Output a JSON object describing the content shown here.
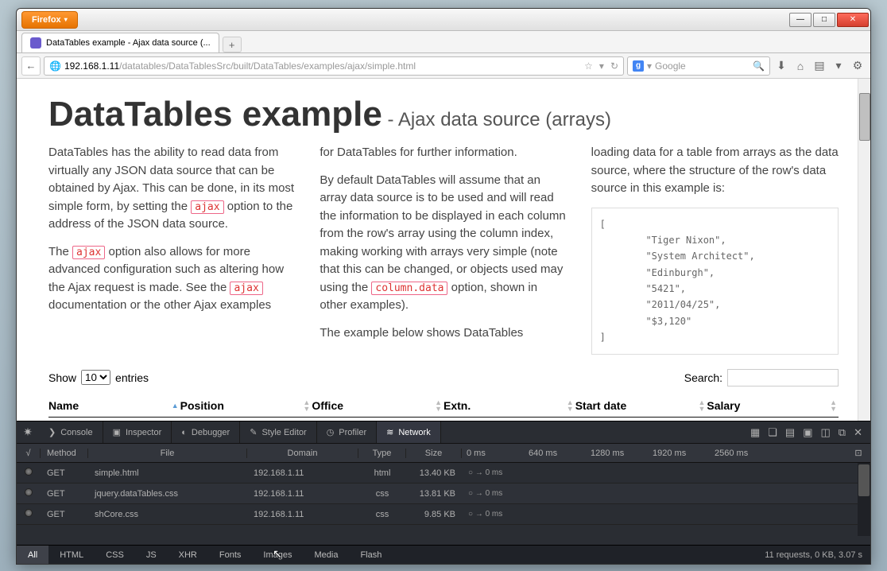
{
  "firefox_button": "Firefox",
  "tab_title": "DataTables example - Ajax data source (...",
  "url": {
    "host": "192.168.1.11",
    "path": "/datatables/DataTablesSrc/built/DataTables/examples/ajax/simple.html"
  },
  "search_placeholder": "Google",
  "page": {
    "title": "DataTables example",
    "subtitle": " - Ajax data source (arrays)",
    "col1_p1a": "DataTables has the ability to read data from virtually any JSON data source that can be obtained by Ajax. This can be done, in its most simple form, by setting the ",
    "col1_p1_code": "ajax",
    "col1_p1b": " option to the address of the JSON data source.",
    "col1_p2a": "The ",
    "col1_p2_code1": "ajax",
    "col1_p2b": " option also allows for more advanced configuration such as altering how the Ajax request is made. See the ",
    "col1_p2_code2": "ajax",
    "col1_p2c": " documentation or the other Ajax examples",
    "col2_p1": "for DataTables for further information.",
    "col2_p2a": "By default DataTables will assume that an array data source is to be used and will read the information to be displayed in each column from the row's array using the column index, making working with arrays very simple (note that this can be changed, or objects used may using the ",
    "col2_p2_code": "column.data",
    "col2_p2b": " option, shown in other examples).",
    "col2_p3": "The example below shows DataTables",
    "col3_p1": "loading data for a table from arrays as the data source, where the structure of the row's data source in this example is:",
    "code_block": "[\n        \"Tiger Nixon\",\n        \"System Architect\",\n        \"Edinburgh\",\n        \"5421\",\n        \"2011/04/25\",\n        \"$3,120\"\n]",
    "show_label": "Show",
    "show_value": "10",
    "entries_label": "entries",
    "search_label": "Search:",
    "headers": [
      "Name",
      "Position",
      "Office",
      "Extn.",
      "Start date",
      "Salary"
    ]
  },
  "devtools": {
    "tabs": {
      "console": "Console",
      "inspector": "Inspector",
      "debugger": "Debugger",
      "styleeditor": "Style Editor",
      "profiler": "Profiler",
      "network": "Network"
    },
    "net_headers": {
      "method": "Method",
      "file": "File",
      "domain": "Domain",
      "type": "Type",
      "size": "Size"
    },
    "time_marks": [
      "0 ms",
      "640 ms",
      "1280 ms",
      "1920 ms",
      "2560 ms"
    ],
    "rows": [
      {
        "method": "GET",
        "file": "simple.html",
        "domain": "192.168.1.11",
        "type": "html",
        "size": "13.40 KB",
        "time": "○ → 0 ms"
      },
      {
        "method": "GET",
        "file": "jquery.dataTables.css",
        "domain": "192.168.1.11",
        "type": "css",
        "size": "13.81 KB",
        "time": "○ → 0 ms"
      },
      {
        "method": "GET",
        "file": "shCore.css",
        "domain": "192.168.1.11",
        "type": "css",
        "size": "9.85 KB",
        "time": "○ → 0 ms"
      }
    ],
    "filters": [
      "All",
      "HTML",
      "CSS",
      "JS",
      "XHR",
      "Fonts",
      "Images",
      "Media",
      "Flash"
    ],
    "status": "11 requests, 0 KB, 3.07 s"
  }
}
